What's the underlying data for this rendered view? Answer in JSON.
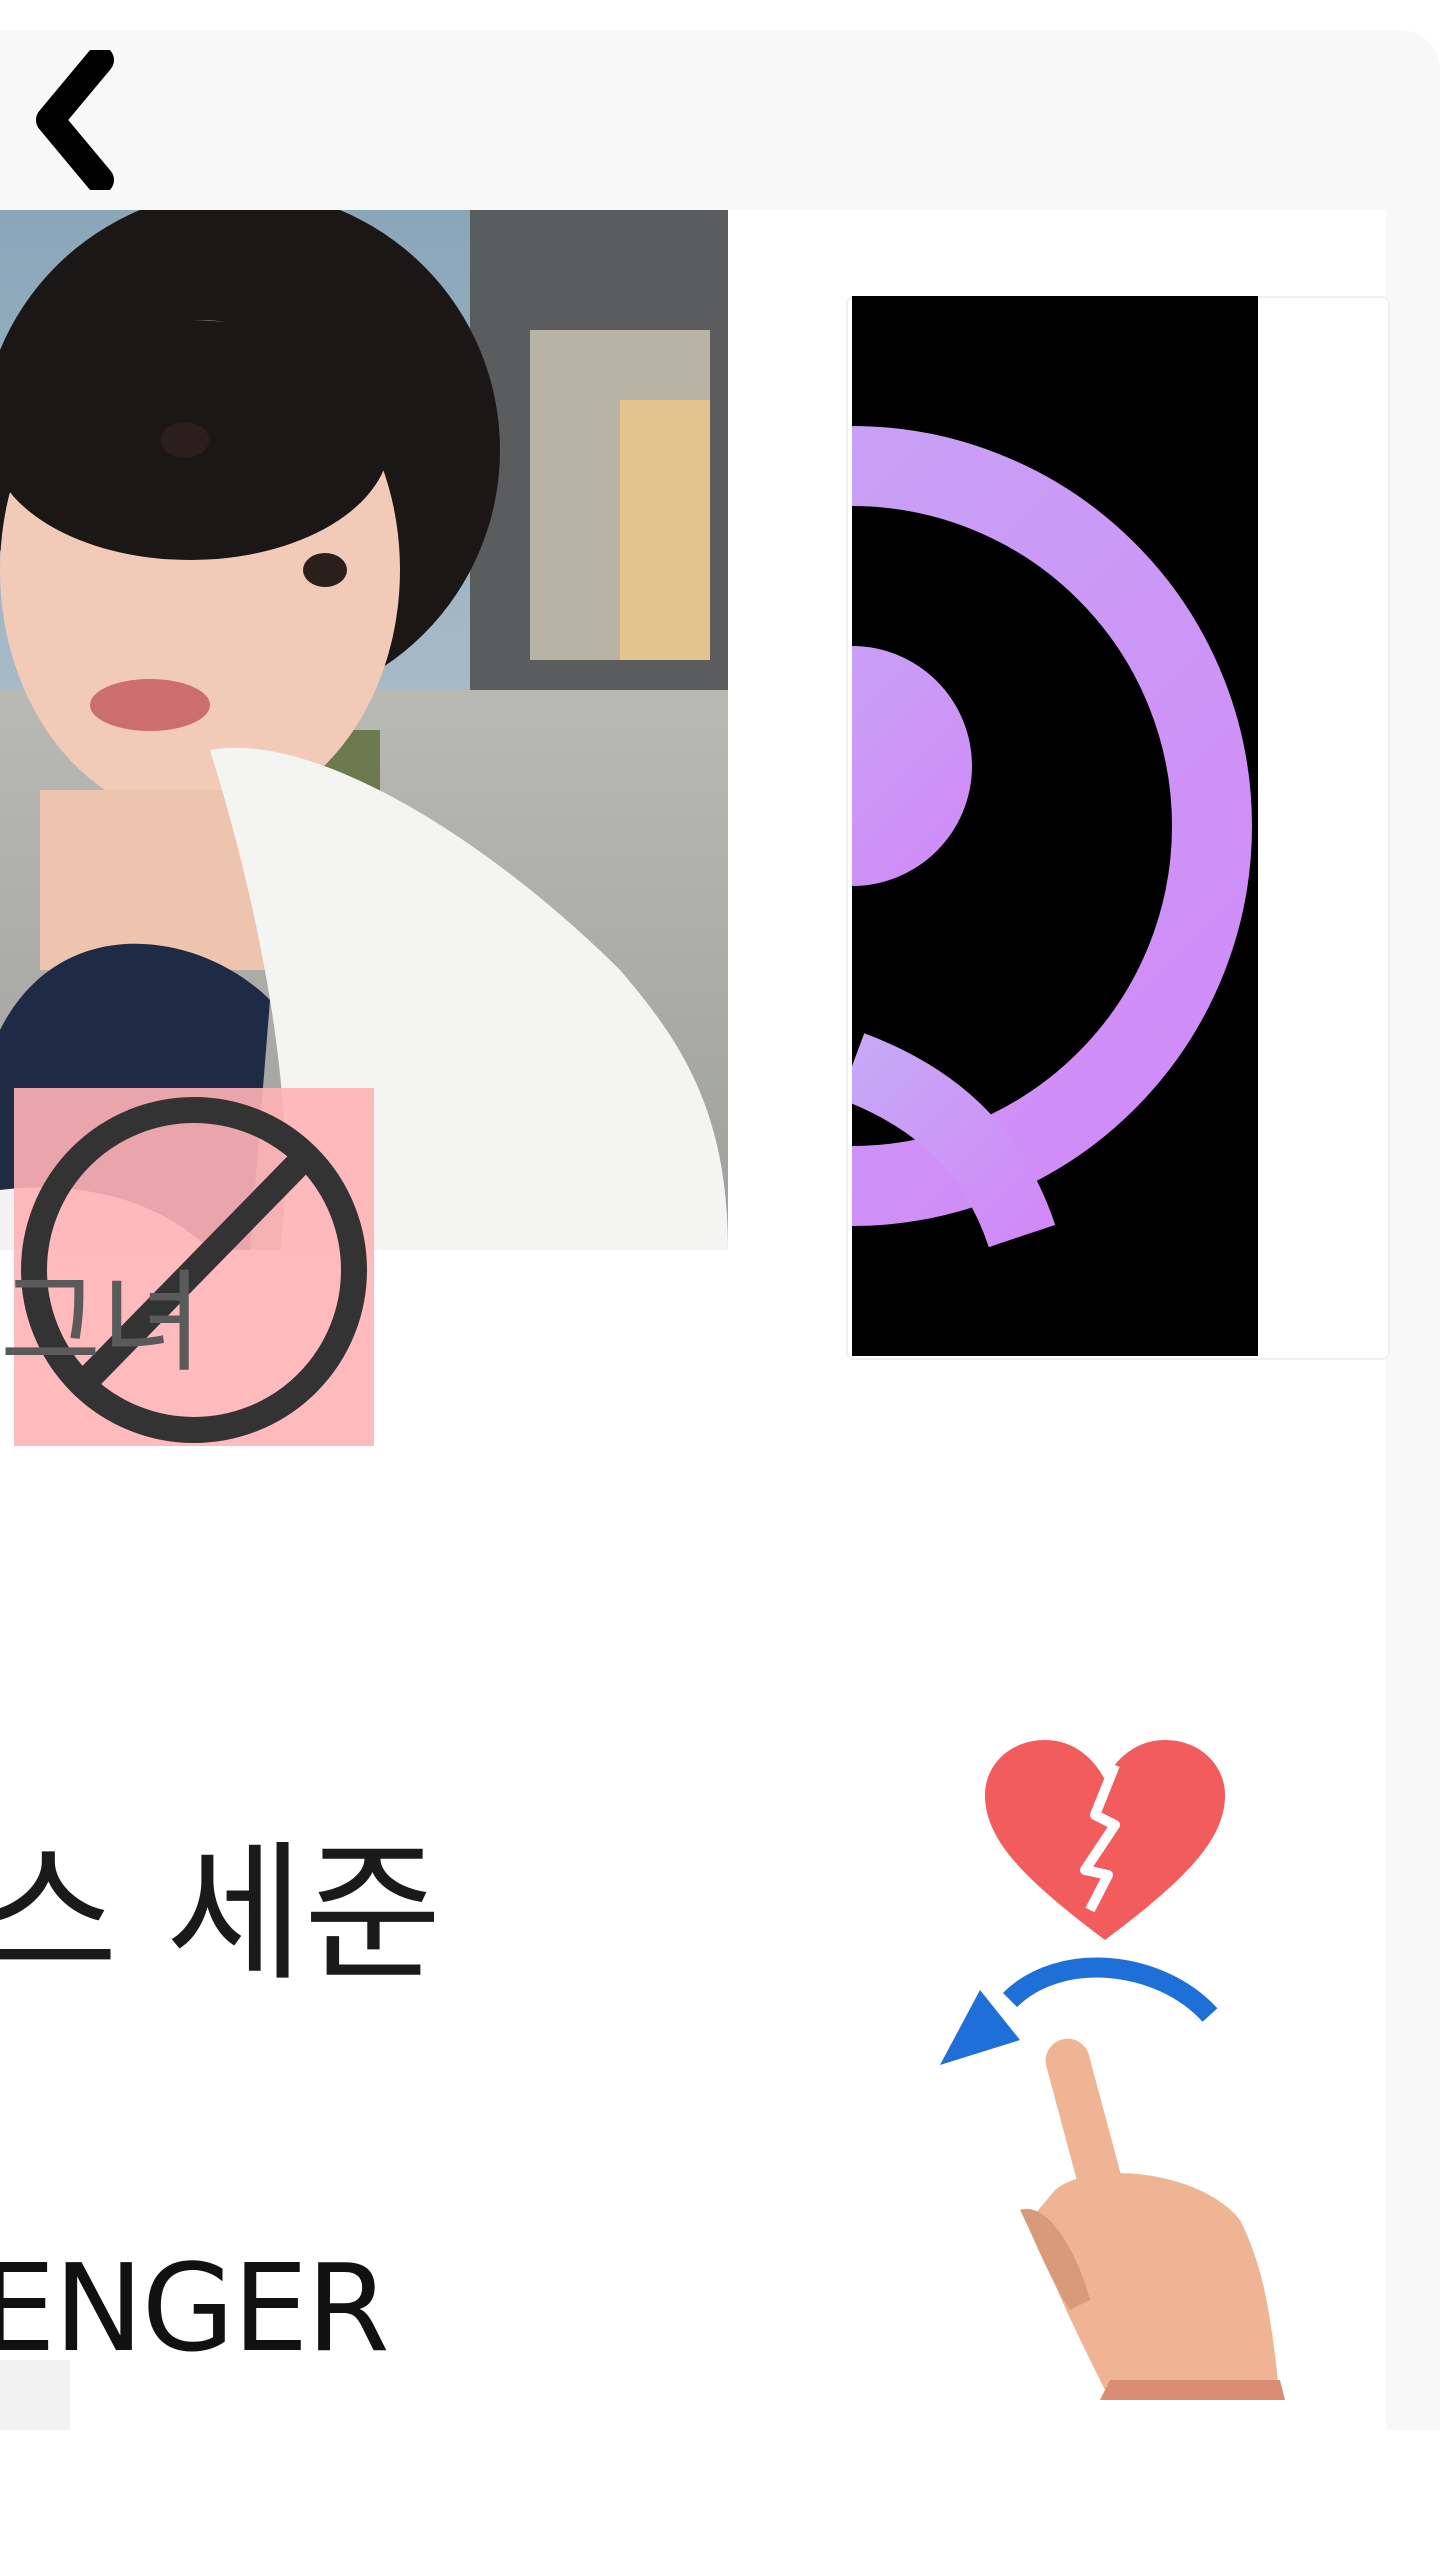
{
  "header": {
    "back_icon": "chevron-left-icon"
  },
  "profile": {
    "overlay_label": "그녀",
    "name_visible": "스 세준",
    "type_visible": "ENGER"
  },
  "icons": {
    "block": "block-icon",
    "swipe_hint": "swipe-left-hand-icon",
    "broken_heart": "broken-heart-icon",
    "logo": "purple-ring-logo"
  },
  "colors": {
    "logo_purple": "#c79cf3",
    "block_bg": "#ffb3b6",
    "heart_red": "#f25c5c",
    "arrow_blue": "#1f6fd9",
    "hand_skin": "#eeb494"
  }
}
